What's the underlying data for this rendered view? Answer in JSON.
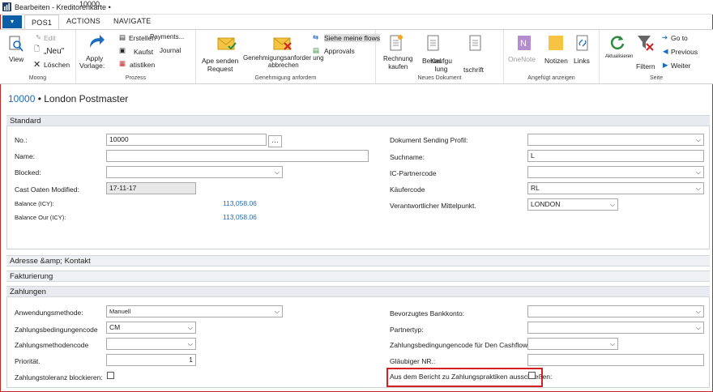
{
  "window": {
    "title": "Bearbeiten - Kreditorenkarte •",
    "record_no": "10000"
  },
  "tabs": {
    "file": "▾",
    "items": [
      "POS1",
      "ACTIONS",
      "NAVIGATE"
    ]
  },
  "ribbon": {
    "view": "View",
    "edit": "Edit",
    "new": "„Neu\"",
    "delete": "Löschen",
    "manage_group": "Moong",
    "apply": "Apply",
    "template": "Vorlage:",
    "create": "Erstellen",
    "payments": "Payments...",
    "purchase": "Kaufst",
    "journal": "Journal",
    "statistics": "atistiken",
    "process_group": "Prozess",
    "send_request": "Ape senden\nRequest",
    "cancel_request": "Genehmigungsanforder ung\nabbrechen",
    "see_flows": "Siehe meine flows",
    "approvals": "Approvals",
    "approval_group": "Genehmigung anfordern",
    "invoice": "Rechnung\nkaufen",
    "order": "Bestel",
    "purchase_order": "Kaufgu\nlung",
    "credit_memo": "tschrift",
    "new_doc_group": "Neues Dokument",
    "onenote": "OneNote",
    "notes": "Notizen",
    "links": "Links",
    "attached_group": "Angefügt anzeigen",
    "refresh": "Aktualisieren",
    "filter": "Filtern",
    "goto": "Go to",
    "previous": "Previous",
    "next": "Weiter",
    "page_group": "Seite"
  },
  "page": {
    "key": "10000",
    "title": " • London Postmaster"
  },
  "sections": {
    "standard": "Standard",
    "address": "Adresse &amp; Kontakt",
    "invoicing": "Fakturierung",
    "payments": "Zahlungen"
  },
  "standard": {
    "no_label": "No.:",
    "no_value": "10000",
    "name_label": "Name:",
    "name_value": "",
    "blocked_label": "Blocked:",
    "blocked_value": "",
    "last_modified_label": "Cast Oaten Modified:",
    "last_modified_value": "17-11-17",
    "balance_label": "Balance (ICY):",
    "balance_value": "113,058.06",
    "balance_due_label": "Balance Our (ICY):",
    "balance_due_value": "113,058.06",
    "doc_profile_label": "Dokument Sending Profil:",
    "doc_profile_value": "",
    "search_name_label": "Suchname:",
    "search_name_value": "L",
    "ic_partner_label": "IC-Partnercode",
    "ic_partner_value": "",
    "purchaser_label": "Käufercode",
    "purchaser_value": "RL",
    "resp_center_label": "Verantwortlicher Mittelpunkt.",
    "resp_center_value": "LONDON"
  },
  "payments": {
    "application_method_label": "Anwendungsmethode:",
    "application_method_value": "Manuell",
    "payment_terms_label": "Zahlungsbedingungencode",
    "payment_terms_value": "CM",
    "payment_method_label": "Zahlungsmethodencode",
    "payment_method_value": "",
    "priority_label": "Priorität.",
    "priority_value": "1",
    "tolerance_label": "Zahlungstoleranz blockieren:",
    "bank_account_label": "Bevorzugtes Bankkonto:",
    "bank_account_value": "",
    "partner_type_label": "Partnertyp:",
    "partner_type_value": "",
    "cashflow_terms_label": "Zahlungsbedingungencode für Den Cashflow",
    "cashflow_terms_value": "",
    "creditor_no_label": "Gläubiger NR.:",
    "creditor_no_value": "",
    "exclude_report_label": "Aus dem Bericht zu Zahlungspraktiken ausschließen:"
  },
  "colors": {
    "accent": "#1a6dc3",
    "file_button": "#0a5ea8",
    "highlight": "#d32020"
  }
}
